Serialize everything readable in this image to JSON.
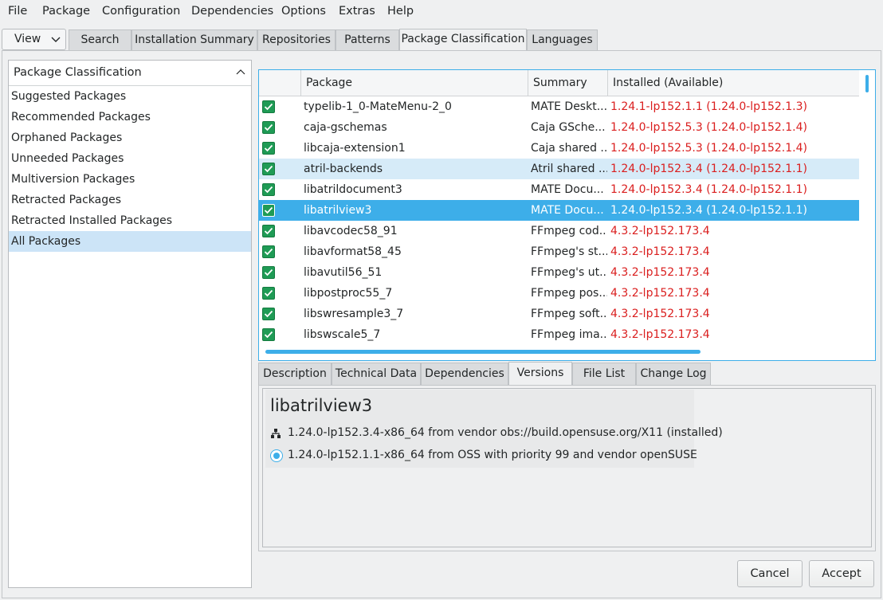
{
  "menubar": [
    "File",
    "Package",
    "Configuration",
    "Dependencies",
    "Options",
    "Extras",
    "Help"
  ],
  "view_button": "View",
  "top_tabs": [
    "Search",
    "Installation Summary",
    "Repositories",
    "Patterns",
    "Package Classification",
    "Languages"
  ],
  "active_top_tab": "Package Classification",
  "left_panel": {
    "title": "Package Classification",
    "items": [
      "Suggested Packages",
      "Recommended Packages",
      "Orphaned Packages",
      "Unneeded Packages",
      "Multiversion Packages",
      "Retracted Packages",
      "Retracted Installed Packages",
      "All Packages"
    ],
    "selected": "All Packages"
  },
  "table": {
    "headers": [
      "Package",
      "Summary",
      "Installed (Available)"
    ],
    "rows": [
      {
        "name": "typelib-1_0-MateMenu-2_0",
        "summary": "MATE Deskt...",
        "version": "1.24.1-lp152.1.1 (1.24.0-lp152.1.3)"
      },
      {
        "name": "caja-gschemas",
        "summary": "Caja GSche...",
        "version": "1.24.0-lp152.5.3 (1.24.0-lp152.1.4)"
      },
      {
        "name": "libcaja-extension1",
        "summary": "Caja shared ...",
        "version": "1.24.0-lp152.5.3 (1.24.0-lp152.1.4)"
      },
      {
        "name": "atril-backends",
        "summary": "Atril shared ...",
        "version": "1.24.0-lp152.3.4 (1.24.0-lp152.1.1)"
      },
      {
        "name": "libatrildocument3",
        "summary": "MATE Docu...",
        "version": "1.24.0-lp152.3.4 (1.24.0-lp152.1.1)"
      },
      {
        "name": "libatrilview3",
        "summary": "MATE Docu...",
        "version": "1.24.0-lp152.3.4 (1.24.0-lp152.1.1)"
      },
      {
        "name": "libavcodec58_91",
        "summary": "FFmpeg cod...",
        "version": "4.3.2-lp152.173.4"
      },
      {
        "name": "libavformat58_45",
        "summary": "FFmpeg's st...",
        "version": "4.3.2-lp152.173.4"
      },
      {
        "name": "libavutil56_51",
        "summary": "FFmpeg's ut...",
        "version": "4.3.2-lp152.173.4"
      },
      {
        "name": "libpostproc55_7",
        "summary": "FFmpeg pos...",
        "version": "4.3.2-lp152.173.4"
      },
      {
        "name": "libswresample3_7",
        "summary": "FFmpeg soft...",
        "version": "4.3.2-lp152.173.4"
      },
      {
        "name": "libswscale5_7",
        "summary": "FFmpeg ima...",
        "version": "4.3.2-lp152.173.4"
      }
    ],
    "selected_row": "libatrilview3",
    "hover_row": "atril-backends"
  },
  "detail_tabs": [
    "Description",
    "Technical Data",
    "Dependencies",
    "Versions",
    "File List",
    "Change Log"
  ],
  "active_detail_tab": "Versions",
  "detail": {
    "title": "libatrilview3",
    "installed_line": "1.24.0-lp152.3.4-x86_64 from vendor obs://build.opensuse.org/X11 (installed)",
    "available_line": "1.24.0-lp152.1.1-x86_64 from OSS with priority 99 and vendor openSUSE"
  },
  "buttons": {
    "cancel": "Cancel",
    "accept": "Accept"
  },
  "colors": {
    "accent": "#3daee9",
    "outdated_version": "#da1e1e",
    "checkbox": "#1f9b55"
  }
}
